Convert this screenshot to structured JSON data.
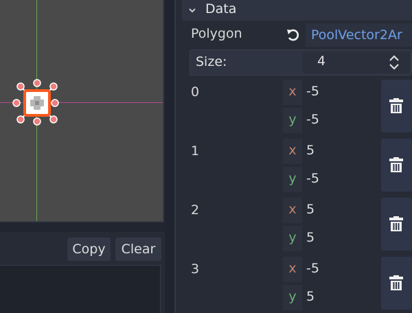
{
  "output": {
    "copy_label": "Copy",
    "clear_label": "Clear"
  },
  "inspector": {
    "section_title": "Data",
    "polygon": {
      "label": "Polygon",
      "value": "PoolVector2Ar"
    },
    "size": {
      "label": "Size:",
      "value": "4"
    },
    "points": [
      {
        "index": "0",
        "x_label": "x",
        "x": "-5",
        "y_label": "y",
        "y": "-5"
      },
      {
        "index": "1",
        "x_label": "x",
        "x": "5",
        "y_label": "y",
        "y": "-5"
      },
      {
        "index": "2",
        "x_label": "x",
        "x": "5",
        "y_label": "y",
        "y": "5"
      },
      {
        "index": "3",
        "x_label": "x",
        "x": "-5",
        "y_label": "y",
        "y": "5"
      }
    ]
  },
  "icons": {
    "section": "chevron-down-icon",
    "revert": "revert-icon",
    "stepper": "up-down-arrows-icon",
    "delete": "trash-icon"
  },
  "colors": {
    "property_value": "#6ea1ea",
    "x_label": "#c4836b",
    "y_label": "#6cae76",
    "selection": "#ff5a1f",
    "handle": "#f08080"
  }
}
